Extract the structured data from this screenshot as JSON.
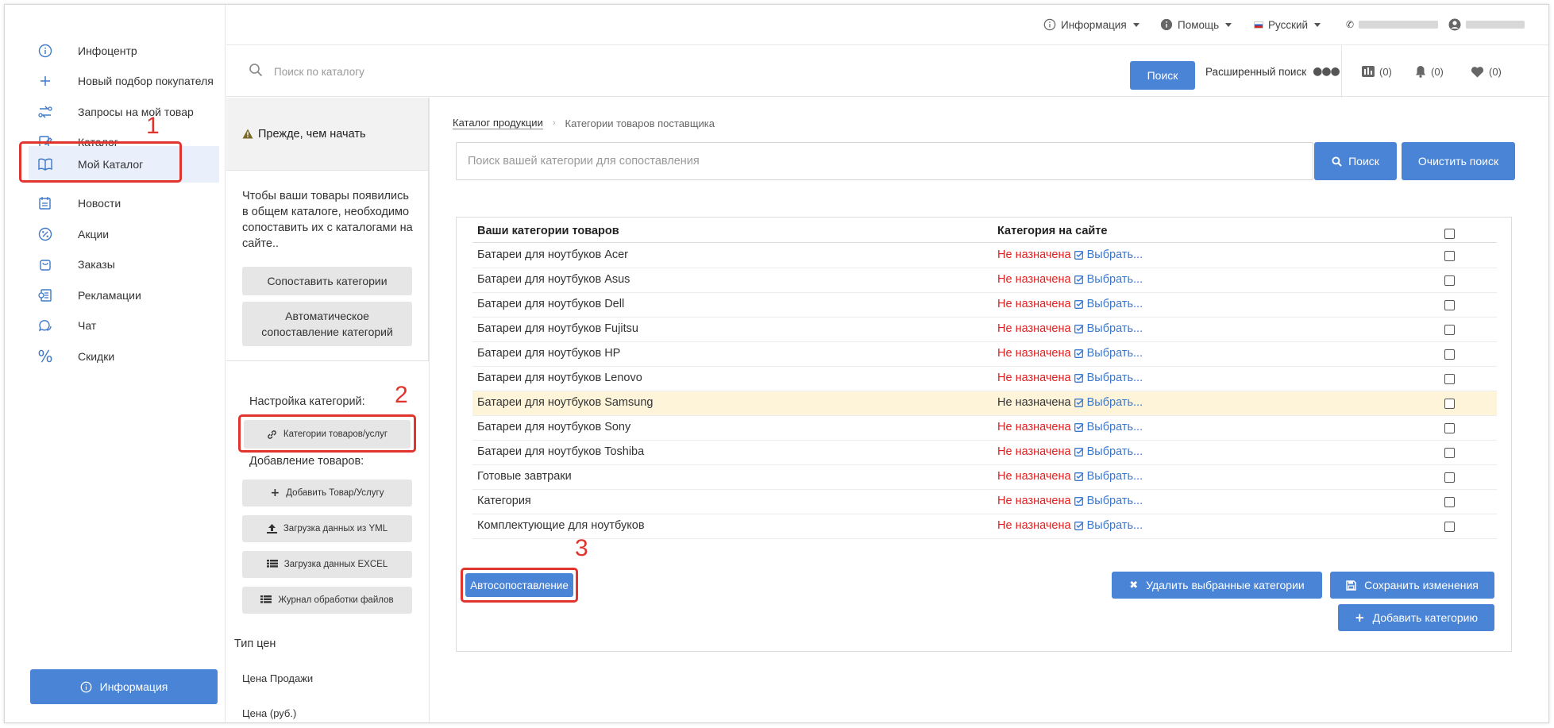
{
  "sidebar": {
    "items": [
      {
        "label": "Инфоцентр",
        "icon": "info-circle-icon"
      },
      {
        "label": "Новый подбор покупателя",
        "icon": "plus-icon"
      },
      {
        "label": "Запросы на мой товар",
        "icon": "swap-icon"
      },
      {
        "label": "Каталог",
        "icon": "catalog-icon"
      },
      {
        "label": "Мой Каталог",
        "icon": "open-book-icon"
      },
      {
        "label": "Новости",
        "icon": "news-icon"
      },
      {
        "label": "Акции",
        "icon": "percent-badge-icon"
      },
      {
        "label": "Заказы",
        "icon": "shopping-bag-icon"
      },
      {
        "label": "Рекламации",
        "icon": "claims-icon"
      },
      {
        "label": "Чат",
        "icon": "chat-icon"
      },
      {
        "label": "Скидки",
        "icon": "percent-icon"
      }
    ],
    "info_button": "Информация"
  },
  "topbar": {
    "info": "Информация",
    "help": "Помощь",
    "language": "Русский"
  },
  "search": {
    "placeholder": "Поиск по каталогу",
    "button": "Поиск",
    "advanced": "Расширенный поиск",
    "compare_count": "(0)",
    "notifications_count": "(0)",
    "favorites_count": "(0)"
  },
  "left_panel": {
    "before_title": "Прежде, чем начать",
    "before_text": "Чтобы ваши товары появились в общем каталоге, необходимо сопоставить их с каталогами на сайте..",
    "match_button": "Сопоставить категории",
    "auto_match_button": "Автоматическое сопоставление категорий",
    "settings_title": "Настройка категорий:",
    "categories_button": "Категории товаров/услуг",
    "add_title": "Добавление товаров:",
    "add_product_button": "Добавить Товар/Услугу",
    "yml_button": "Загрузка данных из YML",
    "excel_button": "Загрузка данных EXCEL",
    "journal_button": "Журнал обработки файлов",
    "price_type_title": "Тип цен",
    "price_type_value": "Цена Продажи",
    "price_type_next": "Цена (руб.)"
  },
  "main": {
    "breadcrumb": [
      "Каталог продукции",
      "Категории товаров поставщика"
    ],
    "category_search_placeholder": "Поиск вашей категории для сопоставления",
    "search_button": "Поиск",
    "clear_button": "Очистить поиск",
    "table": {
      "col_yours": "Ваши категории товаров",
      "col_site": "Категория на сайте",
      "unassigned": "Не назначена",
      "choose": "Выбрать...",
      "rows": [
        "Батареи для ноутбуков Acer",
        "Батареи для ноутбуков Asus",
        "Батареи для ноутбуков Dell",
        "Батареи для ноутбуков Fujitsu",
        "Батареи для ноутбуков HP",
        "Батареи для ноутбуков Lenovo",
        "Батареи для ноутбуков Samsung",
        "Батареи для ноутбуков Sony",
        "Батареи для ноутбуков Toshiba",
        "Готовые завтраки",
        "Категория",
        "Комплектующие для ноутбуков"
      ]
    },
    "auto_button": "Автосопоставление",
    "delete_button": "Удалить выбранные категории",
    "save_button": "Сохранить изменения",
    "add_category_button": "Добавить категорию"
  },
  "annotations": [
    "1",
    "2",
    "3"
  ],
  "colors": {
    "accent": "#4a84d6",
    "highlight": "#e0342c",
    "unassigned": "#e02020"
  }
}
